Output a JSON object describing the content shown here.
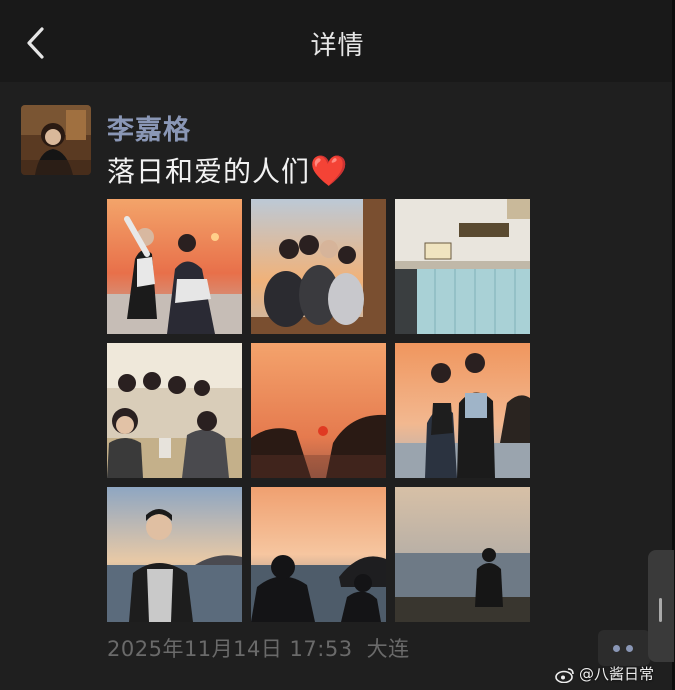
{
  "header": {
    "title": "详情"
  },
  "post": {
    "author": "李嘉格",
    "text": "落日和爱的人们",
    "emoji": "❤️",
    "timestamp": "2025年11月14日 17:53",
    "location": "大连"
  },
  "photos": [
    {
      "subject": "two people posing at sunset beach"
    },
    {
      "subject": "group selfie at sunset"
    },
    {
      "subject": "train carriage interior"
    },
    {
      "subject": "group dinner selfie"
    },
    {
      "subject": "sunset over rocks and sea"
    },
    {
      "subject": "couple at sunset"
    },
    {
      "subject": "man portrait at dusk by sea"
    },
    {
      "subject": "silhouettes at sunset sea"
    },
    {
      "subject": "silhouette figure on beach"
    }
  ],
  "watermark": {
    "text": "@八酱日常"
  },
  "icons": {
    "back": "chevron-left-icon",
    "more": "more-dots-icon",
    "weibo": "weibo-logo"
  },
  "colors": {
    "background": "#1f1f1f",
    "username": "#8a97b6",
    "heart": "#e02a2a"
  }
}
